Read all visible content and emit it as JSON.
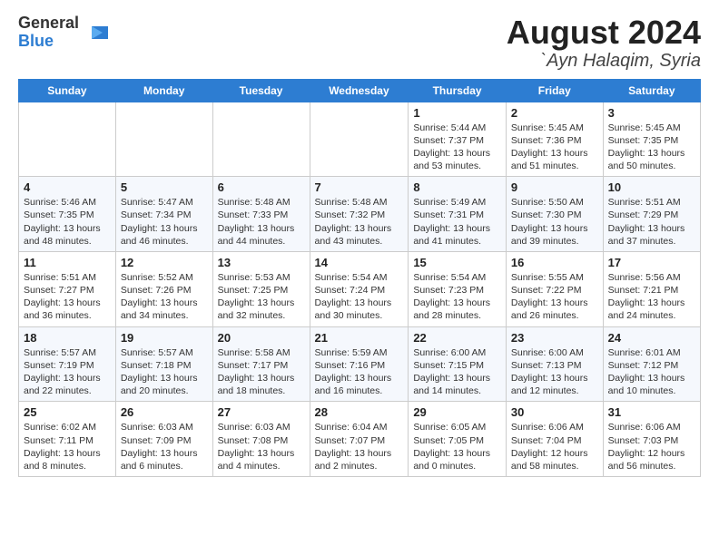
{
  "header": {
    "logo_general": "General",
    "logo_blue": "Blue",
    "title_month": "August 2024",
    "title_location": "`Ayn Halaqim, Syria"
  },
  "weekdays": [
    "Sunday",
    "Monday",
    "Tuesday",
    "Wednesday",
    "Thursday",
    "Friday",
    "Saturday"
  ],
  "weeks": [
    [
      {
        "day": "",
        "info": ""
      },
      {
        "day": "",
        "info": ""
      },
      {
        "day": "",
        "info": ""
      },
      {
        "day": "",
        "info": ""
      },
      {
        "day": "1",
        "info": "Sunrise: 5:44 AM\nSunset: 7:37 PM\nDaylight: 13 hours\nand 53 minutes."
      },
      {
        "day": "2",
        "info": "Sunrise: 5:45 AM\nSunset: 7:36 PM\nDaylight: 13 hours\nand 51 minutes."
      },
      {
        "day": "3",
        "info": "Sunrise: 5:45 AM\nSunset: 7:35 PM\nDaylight: 13 hours\nand 50 minutes."
      }
    ],
    [
      {
        "day": "4",
        "info": "Sunrise: 5:46 AM\nSunset: 7:35 PM\nDaylight: 13 hours\nand 48 minutes."
      },
      {
        "day": "5",
        "info": "Sunrise: 5:47 AM\nSunset: 7:34 PM\nDaylight: 13 hours\nand 46 minutes."
      },
      {
        "day": "6",
        "info": "Sunrise: 5:48 AM\nSunset: 7:33 PM\nDaylight: 13 hours\nand 44 minutes."
      },
      {
        "day": "7",
        "info": "Sunrise: 5:48 AM\nSunset: 7:32 PM\nDaylight: 13 hours\nand 43 minutes."
      },
      {
        "day": "8",
        "info": "Sunrise: 5:49 AM\nSunset: 7:31 PM\nDaylight: 13 hours\nand 41 minutes."
      },
      {
        "day": "9",
        "info": "Sunrise: 5:50 AM\nSunset: 7:30 PM\nDaylight: 13 hours\nand 39 minutes."
      },
      {
        "day": "10",
        "info": "Sunrise: 5:51 AM\nSunset: 7:29 PM\nDaylight: 13 hours\nand 37 minutes."
      }
    ],
    [
      {
        "day": "11",
        "info": "Sunrise: 5:51 AM\nSunset: 7:27 PM\nDaylight: 13 hours\nand 36 minutes."
      },
      {
        "day": "12",
        "info": "Sunrise: 5:52 AM\nSunset: 7:26 PM\nDaylight: 13 hours\nand 34 minutes."
      },
      {
        "day": "13",
        "info": "Sunrise: 5:53 AM\nSunset: 7:25 PM\nDaylight: 13 hours\nand 32 minutes."
      },
      {
        "day": "14",
        "info": "Sunrise: 5:54 AM\nSunset: 7:24 PM\nDaylight: 13 hours\nand 30 minutes."
      },
      {
        "day": "15",
        "info": "Sunrise: 5:54 AM\nSunset: 7:23 PM\nDaylight: 13 hours\nand 28 minutes."
      },
      {
        "day": "16",
        "info": "Sunrise: 5:55 AM\nSunset: 7:22 PM\nDaylight: 13 hours\nand 26 minutes."
      },
      {
        "day": "17",
        "info": "Sunrise: 5:56 AM\nSunset: 7:21 PM\nDaylight: 13 hours\nand 24 minutes."
      }
    ],
    [
      {
        "day": "18",
        "info": "Sunrise: 5:57 AM\nSunset: 7:19 PM\nDaylight: 13 hours\nand 22 minutes."
      },
      {
        "day": "19",
        "info": "Sunrise: 5:57 AM\nSunset: 7:18 PM\nDaylight: 13 hours\nand 20 minutes."
      },
      {
        "day": "20",
        "info": "Sunrise: 5:58 AM\nSunset: 7:17 PM\nDaylight: 13 hours\nand 18 minutes."
      },
      {
        "day": "21",
        "info": "Sunrise: 5:59 AM\nSunset: 7:16 PM\nDaylight: 13 hours\nand 16 minutes."
      },
      {
        "day": "22",
        "info": "Sunrise: 6:00 AM\nSunset: 7:15 PM\nDaylight: 13 hours\nand 14 minutes."
      },
      {
        "day": "23",
        "info": "Sunrise: 6:00 AM\nSunset: 7:13 PM\nDaylight: 13 hours\nand 12 minutes."
      },
      {
        "day": "24",
        "info": "Sunrise: 6:01 AM\nSunset: 7:12 PM\nDaylight: 13 hours\nand 10 minutes."
      }
    ],
    [
      {
        "day": "25",
        "info": "Sunrise: 6:02 AM\nSunset: 7:11 PM\nDaylight: 13 hours\nand 8 minutes."
      },
      {
        "day": "26",
        "info": "Sunrise: 6:03 AM\nSunset: 7:09 PM\nDaylight: 13 hours\nand 6 minutes."
      },
      {
        "day": "27",
        "info": "Sunrise: 6:03 AM\nSunset: 7:08 PM\nDaylight: 13 hours\nand 4 minutes."
      },
      {
        "day": "28",
        "info": "Sunrise: 6:04 AM\nSunset: 7:07 PM\nDaylight: 13 hours\nand 2 minutes."
      },
      {
        "day": "29",
        "info": "Sunrise: 6:05 AM\nSunset: 7:05 PM\nDaylight: 13 hours\nand 0 minutes."
      },
      {
        "day": "30",
        "info": "Sunrise: 6:06 AM\nSunset: 7:04 PM\nDaylight: 12 hours\nand 58 minutes."
      },
      {
        "day": "31",
        "info": "Sunrise: 6:06 AM\nSunset: 7:03 PM\nDaylight: 12 hours\nand 56 minutes."
      }
    ]
  ]
}
